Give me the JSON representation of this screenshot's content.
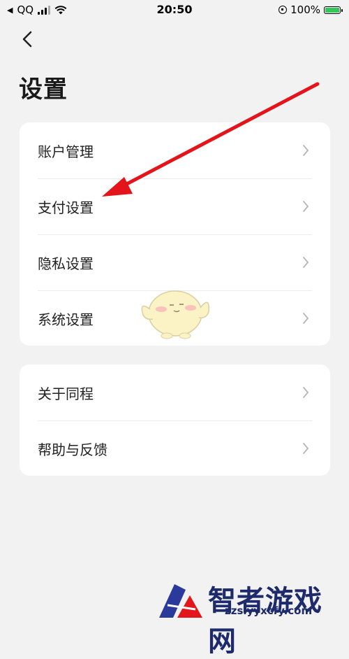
{
  "status_bar": {
    "carrier": "QQ",
    "time": "20:50",
    "battery_percent": "100%",
    "battery_level": 1.0
  },
  "page": {
    "title": "设置"
  },
  "group1": {
    "items": [
      {
        "label": "账户管理"
      },
      {
        "label": "支付设置"
      },
      {
        "label": "隐私设置"
      },
      {
        "label": "系统设置"
      }
    ]
  },
  "group2": {
    "items": [
      {
        "label": "关于同程"
      },
      {
        "label": "帮助与反馈"
      }
    ]
  },
  "watermark": {
    "name": "智者游戏网",
    "url": "zzslyyxcfy.com"
  },
  "colors": {
    "background": "#f2f2f2",
    "card": "#ffffff",
    "arrow": "#e3151a",
    "chevron": "#b5b5b5"
  },
  "icons": {
    "back": "chevron-left-icon",
    "row_chevron": "chevron-right-icon"
  }
}
